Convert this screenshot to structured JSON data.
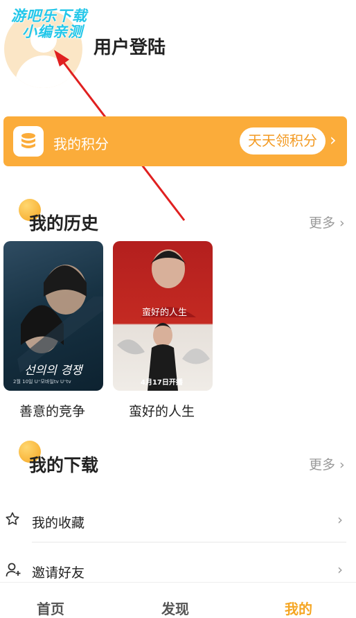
{
  "watermark": {
    "line1": "游吧乐下载",
    "line2": "小编亲测"
  },
  "header": {
    "login_label": "用户登陆",
    "avatar_icon": "user-avatar-icon"
  },
  "points": {
    "label": "我的积分",
    "button_label": "天天领积分",
    "icon": "coin-stack-icon",
    "color": "#fbac3a"
  },
  "history": {
    "title": "我的历史",
    "more_label": "更多",
    "items": [
      {
        "title": "善意的竞争",
        "poster_text": "선의의 경쟁",
        "poster_date": "2월 10일 U⁺모바일tv U⁺tv"
      },
      {
        "title": "蛮好的人生",
        "poster_text": "蛮好的人生",
        "poster_date": "4月17日开播"
      }
    ]
  },
  "downloads": {
    "title": "我的下载",
    "more_label": "更多"
  },
  "list": [
    {
      "label": "我的收藏",
      "icon": "star-icon"
    },
    {
      "label": "邀请好友",
      "icon": "add-user-icon"
    }
  ],
  "nav": {
    "items": [
      {
        "label": "首页",
        "active": false
      },
      {
        "label": "发现",
        "active": false
      },
      {
        "label": "我的",
        "active": true
      }
    ],
    "active_color": "#f5a623"
  }
}
